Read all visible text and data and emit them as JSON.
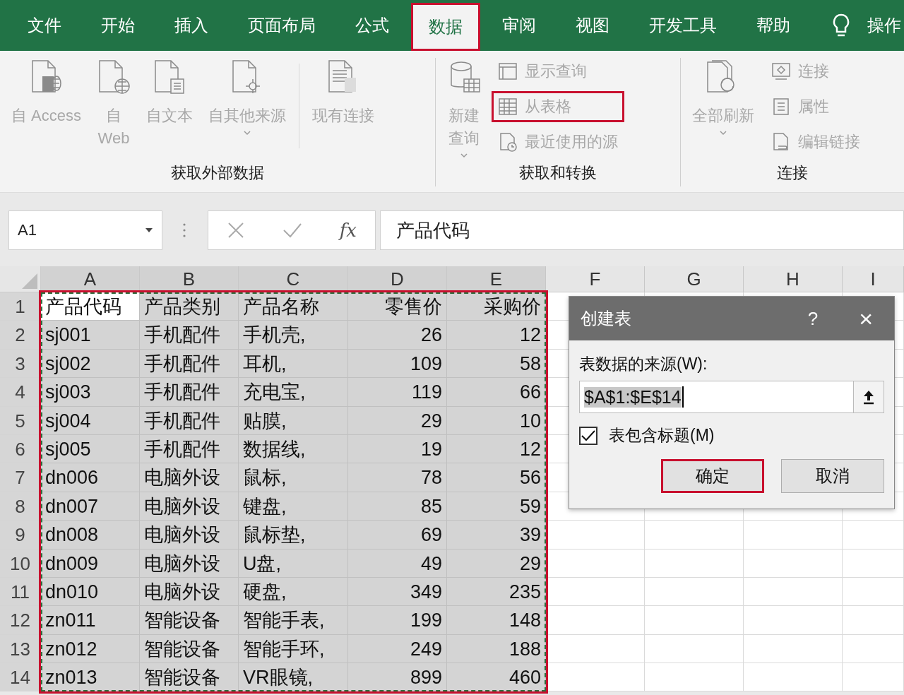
{
  "ribbon_tabs": [
    {
      "label": "文件",
      "selected": false,
      "highlighted": false
    },
    {
      "label": "开始",
      "selected": false,
      "highlighted": false
    },
    {
      "label": "插入",
      "selected": false,
      "highlighted": false
    },
    {
      "label": "页面布局",
      "selected": false,
      "highlighted": false
    },
    {
      "label": "公式",
      "selected": false,
      "highlighted": false
    },
    {
      "label": "数据",
      "selected": true,
      "highlighted": true
    },
    {
      "label": "审阅",
      "selected": false,
      "highlighted": false
    },
    {
      "label": "视图",
      "selected": false,
      "highlighted": false
    },
    {
      "label": "开发工具",
      "selected": false,
      "highlighted": false
    },
    {
      "label": "帮助",
      "selected": false,
      "highlighted": false
    }
  ],
  "tell_me": {
    "label": "操作"
  },
  "ribbon_groups": [
    {
      "title": "获取外部数据",
      "items": [
        {
          "kind": "large",
          "label": "自 Access",
          "disabled": true,
          "dropdown": false,
          "highlighted": false
        },
        {
          "kind": "large",
          "label": "自\nWeb",
          "disabled": true,
          "dropdown": false,
          "highlighted": false
        },
        {
          "kind": "large",
          "label": "自文本",
          "disabled": true,
          "dropdown": false,
          "highlighted": false
        },
        {
          "kind": "large",
          "label": "自其他来源",
          "disabled": true,
          "dropdown": true,
          "highlighted": false
        },
        {
          "kind": "separator"
        },
        {
          "kind": "large",
          "label": "现有连接",
          "disabled": true,
          "dropdown": false,
          "highlighted": false
        }
      ]
    },
    {
      "title": "获取和转换",
      "items": [
        {
          "kind": "large",
          "label": "新建查询",
          "disabled": true,
          "dropdown": true,
          "highlighted": false
        },
        {
          "kind": "small",
          "label": "显示查询",
          "disabled": true,
          "highlighted": false
        },
        {
          "kind": "small",
          "label": "从表格",
          "disabled": true,
          "highlighted": true
        },
        {
          "kind": "small",
          "label": "最近使用的源",
          "disabled": true,
          "highlighted": false
        }
      ]
    },
    {
      "title": "连接",
      "items": [
        {
          "kind": "large",
          "label": "全部刷新",
          "disabled": true,
          "dropdown": true,
          "highlighted": false
        },
        {
          "kind": "small",
          "label": "连接",
          "disabled": true,
          "highlighted": false
        },
        {
          "kind": "small",
          "label": "属性",
          "disabled": true,
          "highlighted": false
        },
        {
          "kind": "small",
          "label": "编辑链接",
          "disabled": true,
          "highlighted": false
        }
      ]
    }
  ],
  "formula_bar": {
    "name_box": "A1",
    "function_label": "fx",
    "formula": "产品代码"
  },
  "sheet": {
    "columns": [
      {
        "label": "A",
        "selected": true,
        "kind": "text"
      },
      {
        "label": "B",
        "selected": true,
        "kind": "text"
      },
      {
        "label": "C",
        "selected": true,
        "kind": "text"
      },
      {
        "label": "D",
        "selected": true,
        "kind": "number"
      },
      {
        "label": "E",
        "selected": true,
        "kind": "number"
      },
      {
        "label": "F",
        "selected": false,
        "kind": "text"
      },
      {
        "label": "G",
        "selected": false,
        "kind": "text"
      },
      {
        "label": "H",
        "selected": false,
        "kind": "text"
      },
      {
        "label": "I",
        "selected": false,
        "kind": "text"
      }
    ],
    "range_marked": true,
    "range_highlighted": true,
    "rows": [
      {
        "number": "1",
        "selected": true,
        "cells": [
          "产品代码",
          "产品类别",
          "产品名称",
          "零售价",
          "采购价"
        ]
      },
      {
        "number": "2",
        "selected": true,
        "cells": [
          "sj001",
          "手机配件",
          "手机壳,",
          "26",
          "12"
        ]
      },
      {
        "number": "3",
        "selected": true,
        "cells": [
          "sj002",
          "手机配件",
          "耳机,",
          "109",
          "58"
        ]
      },
      {
        "number": "4",
        "selected": true,
        "cells": [
          "sj003",
          "手机配件",
          "充电宝,",
          "119",
          "66"
        ]
      },
      {
        "number": "5",
        "selected": true,
        "cells": [
          "sj004",
          "手机配件",
          "贴膜,",
          "29",
          "10"
        ]
      },
      {
        "number": "6",
        "selected": true,
        "cells": [
          "sj005",
          "手机配件",
          "数据线,",
          "19",
          "12"
        ]
      },
      {
        "number": "7",
        "selected": true,
        "cells": [
          "dn006",
          "电脑外设",
          "鼠标,",
          "78",
          "56"
        ]
      },
      {
        "number": "8",
        "selected": true,
        "cells": [
          "dn007",
          "电脑外设",
          "键盘,",
          "85",
          "59"
        ]
      },
      {
        "number": "9",
        "selected": true,
        "cells": [
          "dn008",
          "电脑外设",
          "鼠标垫,",
          "69",
          "39"
        ]
      },
      {
        "number": "10",
        "selected": true,
        "cells": [
          "dn009",
          "电脑外设",
          "U盘,",
          "49",
          "29"
        ]
      },
      {
        "number": "11",
        "selected": true,
        "cells": [
          "dn010",
          "电脑外设",
          "硬盘,",
          "349",
          "235"
        ]
      },
      {
        "number": "12",
        "selected": true,
        "cells": [
          "zn011",
          "智能设备",
          "智能手表,",
          "199",
          "148"
        ]
      },
      {
        "number": "13",
        "selected": true,
        "cells": [
          "zn012",
          "智能设备",
          "智能手环,",
          "249",
          "188"
        ]
      },
      {
        "number": "14",
        "selected": true,
        "cells": [
          "zn013",
          "智能设备",
          "VR眼镜,",
          "899",
          "460"
        ]
      }
    ]
  },
  "dialog": {
    "title": "创建表",
    "help": "?",
    "close": "×",
    "source_label": "表数据的来源(W):",
    "source_value": "$A$1:$E$14",
    "value_selected": true,
    "header_checkbox": {
      "label": "表包含标题(M)",
      "checked": true
    },
    "buttons": [
      {
        "label": "确定",
        "highlighted": true
      },
      {
        "label": "取消",
        "highlighted": false
      }
    ]
  }
}
